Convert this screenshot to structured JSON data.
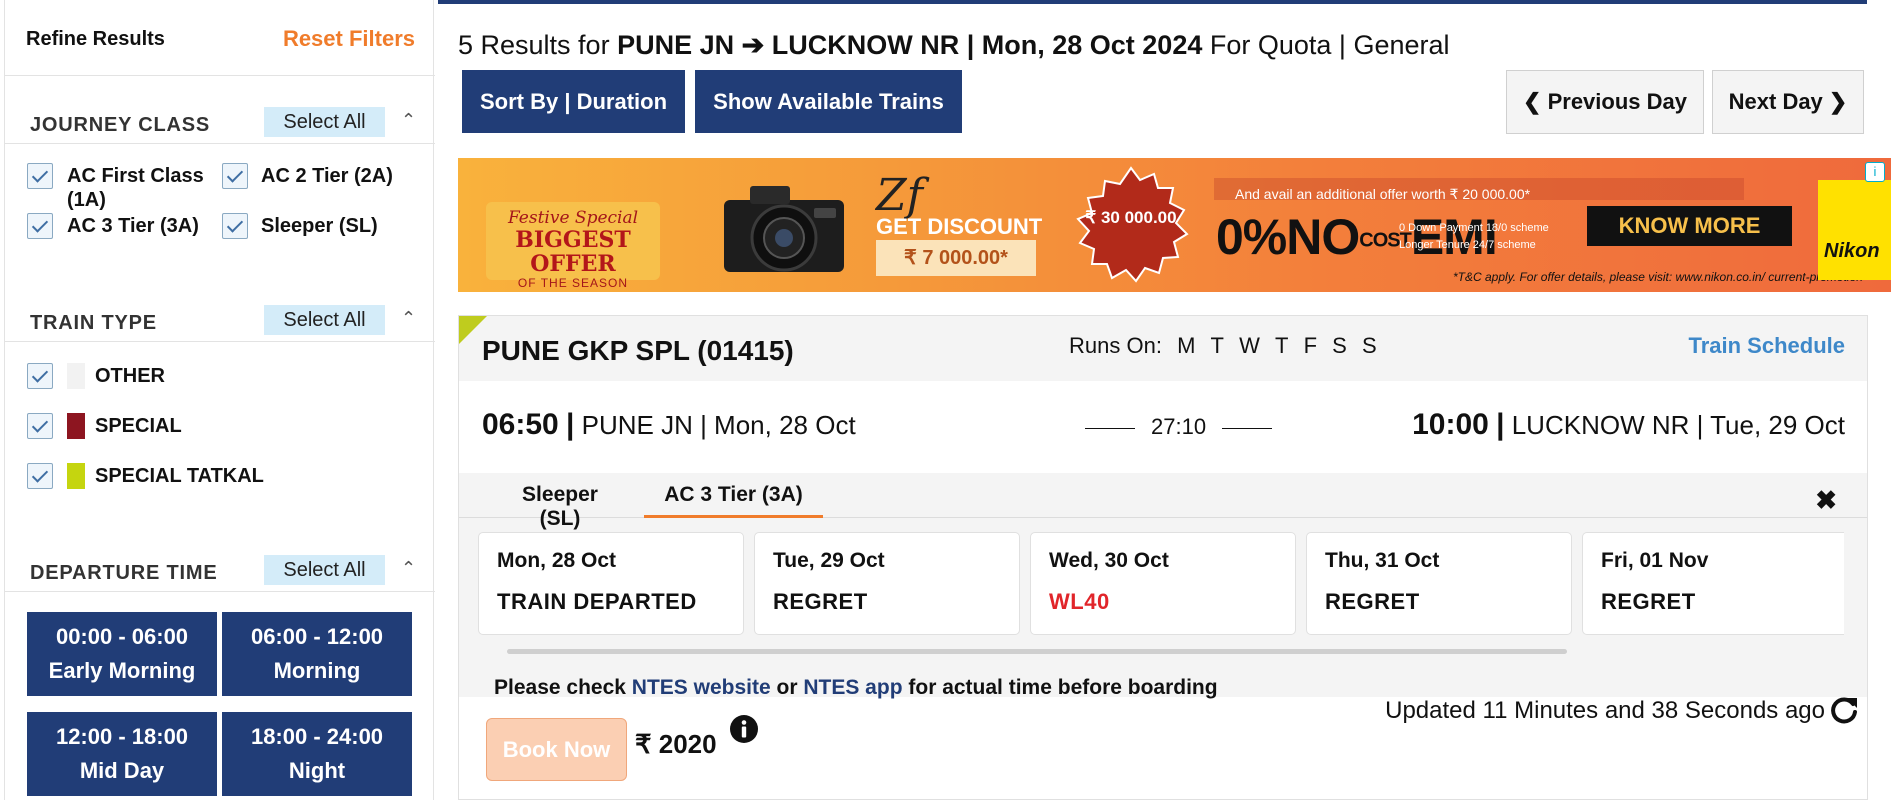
{
  "sidebar": {
    "title": "Refine Results",
    "reset_label": "Reset Filters",
    "journey_class": {
      "title": "JOURNEY CLASS",
      "select_all": "Select All",
      "options": [
        {
          "label": "AC First Class (1A)",
          "checked": true
        },
        {
          "label": "AC 2 Tier (2A)",
          "checked": true
        },
        {
          "label": "AC 3 Tier (3A)",
          "checked": true
        },
        {
          "label": "Sleeper (SL)",
          "checked": true
        }
      ]
    },
    "train_type": {
      "title": "TRAIN TYPE",
      "select_all": "Select All",
      "options": [
        {
          "label": "OTHER",
          "color": "#f2f2f2",
          "checked": true
        },
        {
          "label": "SPECIAL",
          "color": "#8d1520",
          "checked": true
        },
        {
          "label": "SPECIAL TATKAL",
          "color": "#c5d50f",
          "checked": true
        }
      ]
    },
    "departure_time": {
      "title": "DEPARTURE TIME",
      "select_all": "Select All",
      "slots": [
        {
          "range": "00:00 - 06:00",
          "label": "Early Morning"
        },
        {
          "range": "06:00 - 12:00",
          "label": "Morning"
        },
        {
          "range": "12:00 - 18:00",
          "label": "Mid Day"
        },
        {
          "range": "18:00 - 24:00",
          "label": "Night"
        }
      ]
    }
  },
  "results": {
    "count_prefix": "5 Results for",
    "route": "PUNE JN ➔ LUCKNOW NR | Mon, 28 Oct 2024",
    "quota": "For Quota | General",
    "sort_label": "Sort By | Duration",
    "available_label": "Show Available Trains",
    "prev_day": "Previous Day",
    "next_day": "Next Day"
  },
  "ad": {
    "festive": "Festive Special",
    "biggest": "BIGGEST OFFER",
    "season": "OF THE SEASON",
    "model": "Zf",
    "get_discount": "GET DISCOUNT",
    "discount_price": "₹ 7 000.00*",
    "seal": "₹ 30 000.00",
    "avail_offer": "And avail an additional offer worth ₹ 20 000.00*",
    "no": "0%NO",
    "cost": "COST",
    "emi": "EMI",
    "down_payment": "0 Down Payment 18/0 scheme",
    "tenure": "Longer Tenure 24/7 scheme",
    "know_more": "KNOW MORE",
    "tc": "*T&C apply. For offer details, please visit: www.nikon.co.in/ current-promotion",
    "brand": "Nikon",
    "info": "i"
  },
  "train": {
    "name": "PUNE GKP SPL (01415)",
    "runs_on_label": "Runs On:",
    "runs_on_days": [
      "M",
      "T",
      "W",
      "T",
      "F",
      "S",
      "S"
    ],
    "schedule_label": "Train Schedule",
    "dep_time": "06:50",
    "dep_info": "PUNE JN | Mon, 28 Oct",
    "duration": "27:10",
    "arr_time": "10:00",
    "arr_info": "LUCKNOW NR | Tue, 29 Oct",
    "tabs": [
      "Sleeper (SL)",
      "AC 3 Tier (3A)"
    ],
    "active_tab": "AC 3 Tier (3A)",
    "availability": [
      {
        "date": "Mon, 28 Oct",
        "status": "TRAIN DEPARTED"
      },
      {
        "date": "Tue, 29 Oct",
        "status": "REGRET"
      },
      {
        "date": "Wed, 30 Oct",
        "status": "WL40"
      },
      {
        "date": "Thu, 31 Oct",
        "status": "REGRET"
      },
      {
        "date": "Fri, 01 Nov",
        "status": "REGRET"
      }
    ],
    "ntes_prefix": "Please check",
    "ntes_website": "NTES website",
    "ntes_or": "or",
    "ntes_app": "NTES app",
    "ntes_suffix": "for actual time before boarding",
    "updated": "Updated 11 Minutes and 38 Seconds ago",
    "book_label": "Book Now",
    "fare": "₹ 2020"
  },
  "colors": {
    "primary": "#213d77",
    "accent": "#f07c2b",
    "link": "#3e88c9",
    "waitlist": "#e1252a"
  }
}
